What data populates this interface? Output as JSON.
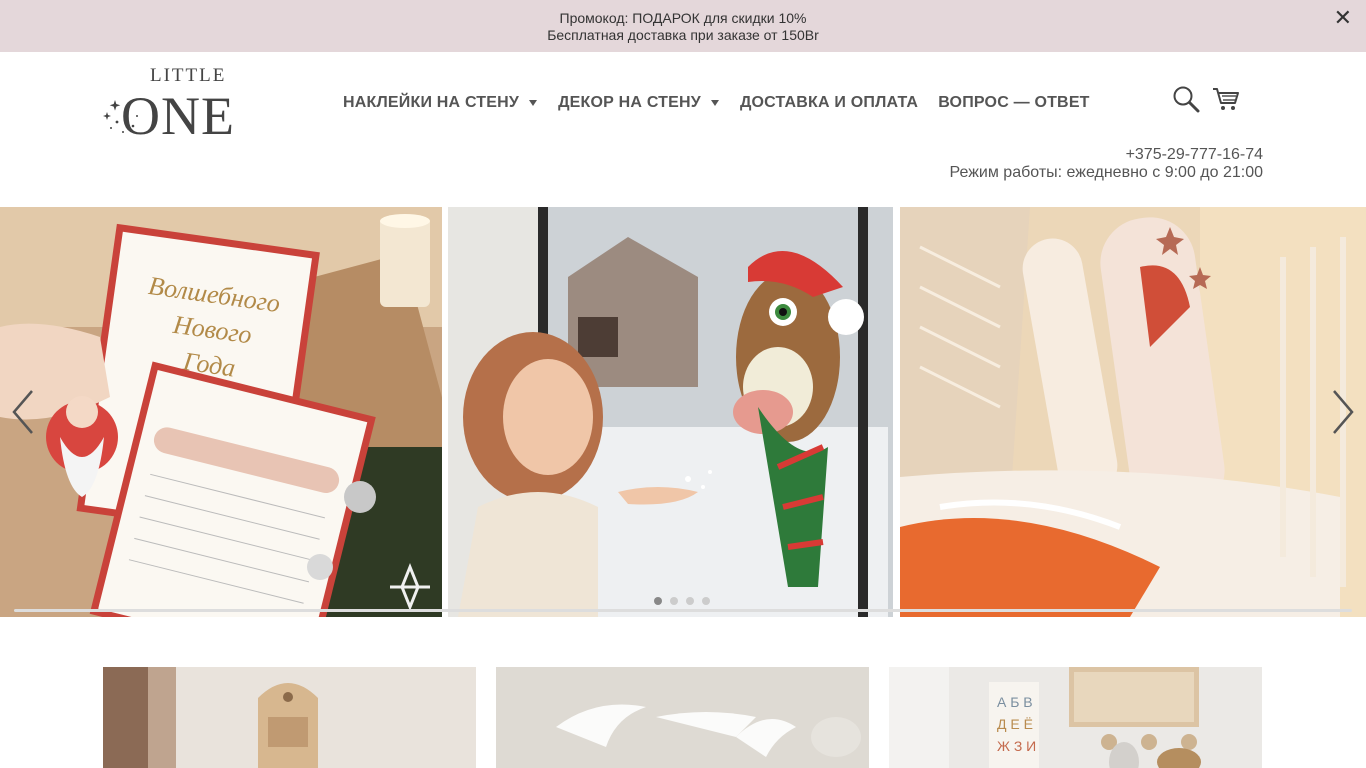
{
  "promo": {
    "line1": "Промокод: ПОДАРОК для скидки 10%",
    "line2": "Бесплатная доставка при заказе от 150Br",
    "close": "✕"
  },
  "logo": {
    "small": "LITTLE",
    "big": "ONE"
  },
  "nav": [
    {
      "label": "НАКЛЕЙКИ НА СТЕНУ",
      "dropdown": true
    },
    {
      "label": "ДЕКОР НА СТЕНУ",
      "dropdown": true
    },
    {
      "label": "ДОСТАВКА И ОПЛАТА",
      "dropdown": false
    },
    {
      "label": "ВОПРОС — ОТВЕТ",
      "dropdown": false
    }
  ],
  "contact": {
    "phone": "+375-29-777-16-74",
    "hours": "Режим работы: ежедневно с 9:00 до 21:00"
  },
  "social": [
    "instagram-icon",
    "telegram-icon",
    "whatsapp-icon"
  ],
  "slider": {
    "dots": 4,
    "active": 0
  },
  "colors": {
    "promo_bg": "#e4d7da",
    "text": "#555555"
  }
}
